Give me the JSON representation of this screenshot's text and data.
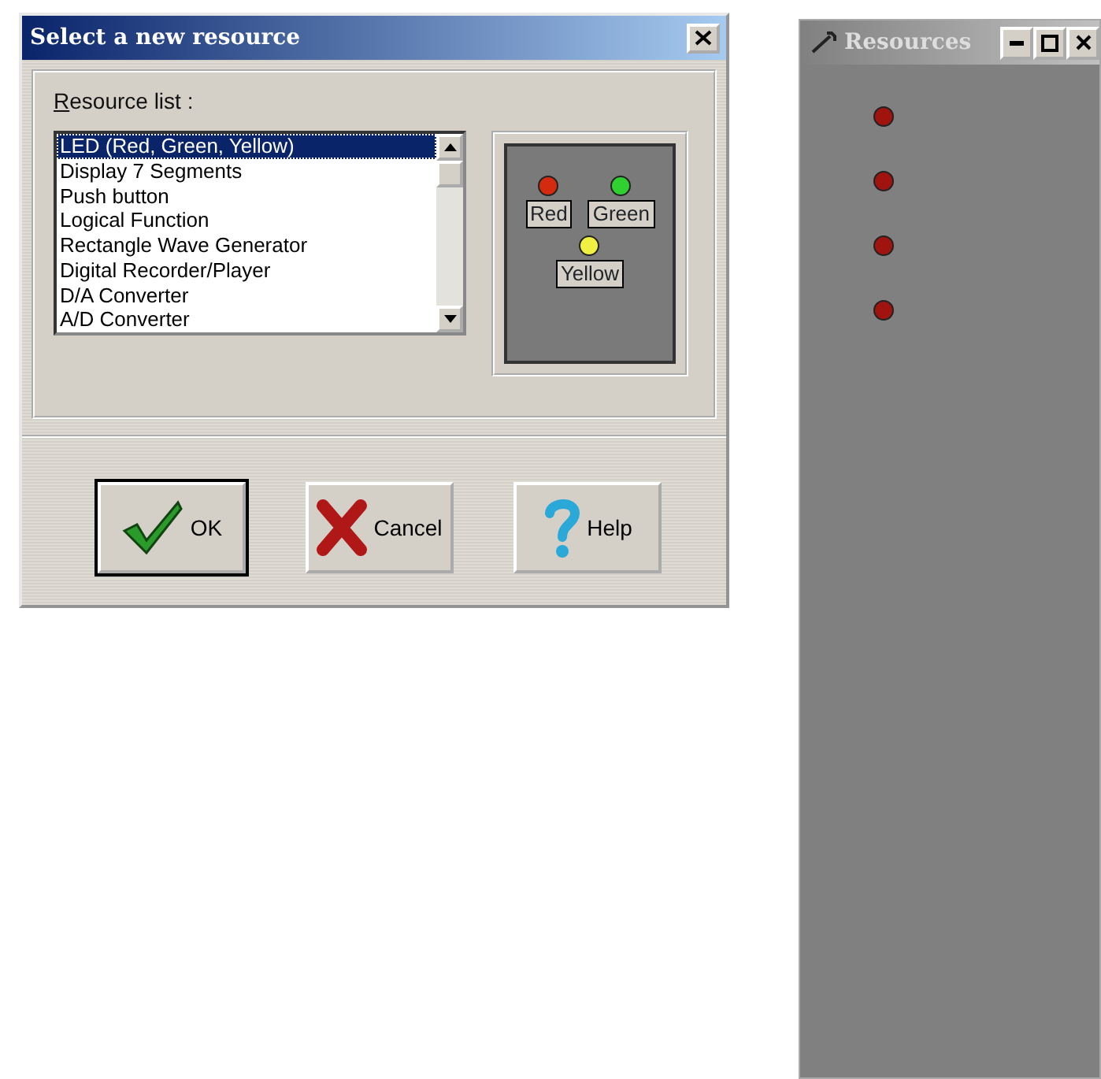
{
  "dialog": {
    "title": "Select a new resource",
    "resource_list": {
      "access_key": "R",
      "label_rest": "esource list :",
      "items": [
        {
          "label": "LED (Red, Green, Yellow)",
          "selected": true
        },
        {
          "label": "Display 7 Segments",
          "selected": false
        },
        {
          "label": "Push button",
          "selected": false
        },
        {
          "label": "Logical Function",
          "selected": false
        },
        {
          "label": "Rectangle Wave Generator",
          "selected": false
        },
        {
          "label": "Digital Recorder/Player",
          "selected": false
        },
        {
          "label": "D/A Converter",
          "selected": false
        },
        {
          "label": "A/D Converter",
          "selected": false
        }
      ]
    },
    "preview": {
      "leds": [
        {
          "label": "Red",
          "color": "#d42a10"
        },
        {
          "label": "Green",
          "color": "#30d030"
        },
        {
          "label": "Yellow",
          "color": "#f0f040"
        }
      ]
    },
    "buttons": [
      {
        "label": "OK",
        "kind": "ok",
        "default": true
      },
      {
        "label": "Cancel",
        "kind": "cancel",
        "default": false
      },
      {
        "label": "Help",
        "kind": "help",
        "default": false
      }
    ]
  },
  "resources_window": {
    "title": "Resources",
    "leds": [
      {
        "color": "#a01410"
      },
      {
        "color": "#a01410"
      },
      {
        "color": "#a01410"
      },
      {
        "color": "#a01410"
      }
    ]
  }
}
